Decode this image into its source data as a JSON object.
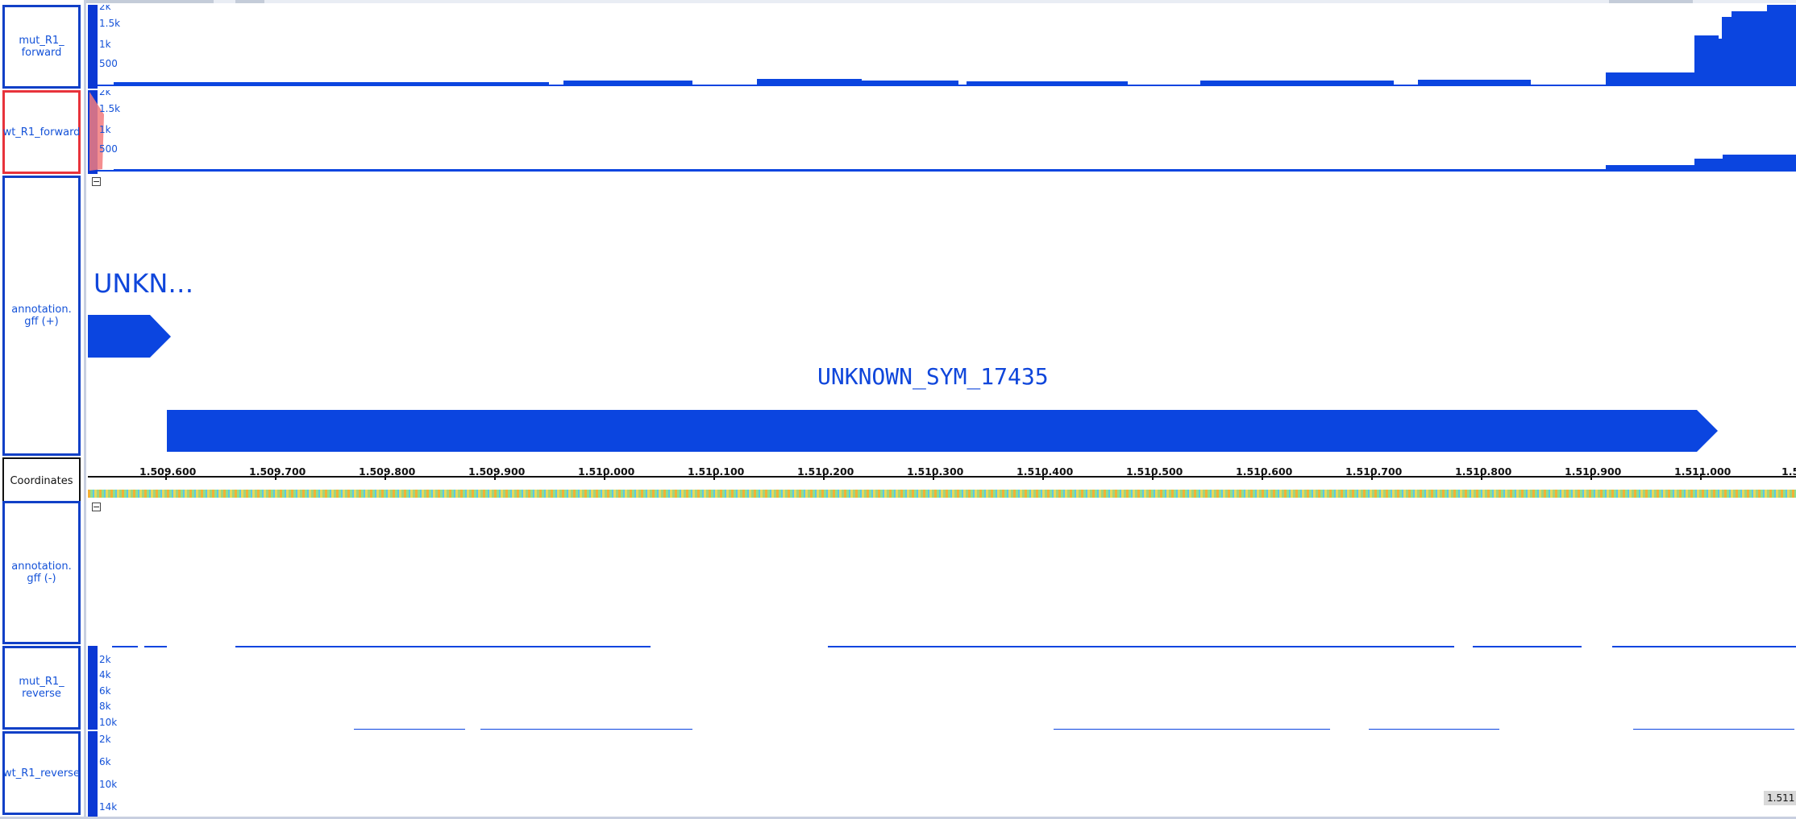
{
  "track_labels": {
    "mut_forward": "mut_R1_\nforward",
    "wt_forward": "wt_R1_forward",
    "annot_plus": "annotation.\ngff (+)",
    "coords": "Coordinates",
    "annot_minus": "annotation.\ngff (-)",
    "mut_reverse": "mut_R1_\nreverse",
    "wt_reverse": "wt_R1_reverse"
  },
  "mut_forward_ticks": [
    "2k",
    "1.5k",
    "1k",
    "500"
  ],
  "wt_forward_ticks": [
    "2k",
    "1.5k",
    "1k",
    "500"
  ],
  "mut_reverse_ticks": [
    "2k",
    "4k",
    "6k",
    "8k",
    "10k"
  ],
  "wt_reverse_ticks": [
    "2k",
    "6k",
    "10k",
    "14k"
  ],
  "features": {
    "gene1_label": "UNKN…",
    "gene2_label": "UNKNOWN_SYM_17435"
  },
  "ruler": {
    "ticks": [
      "1.509.600",
      "1.509.700",
      "1.509.800",
      "1.509.900",
      "1.510.000",
      "1.510.100",
      "1.510.200",
      "1.510.300",
      "1.510.400",
      "1.510.500",
      "1.510.600",
      "1.510.700",
      "1.510.800",
      "1.510.900",
      "1.511.000",
      "1.5"
    ]
  },
  "corner_readout": "1.511",
  "colors": {
    "track_blue": "#0b45e0",
    "selected_border": "#e8333b",
    "label_blue": "#1452d8"
  }
}
